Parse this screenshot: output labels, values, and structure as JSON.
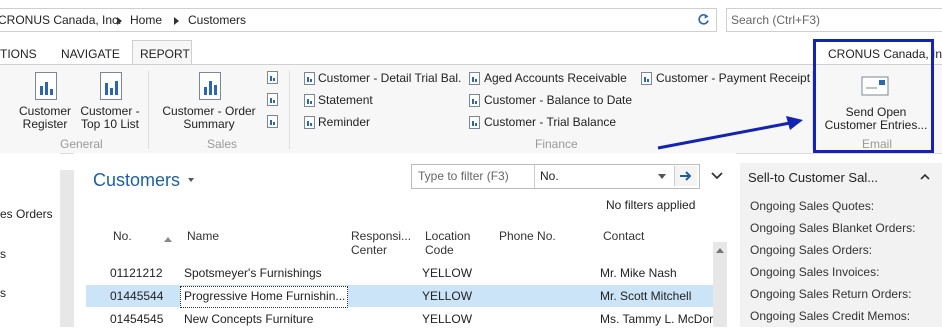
{
  "address": {
    "crumbs": [
      "CRONUS Canada, Inc.",
      "Home",
      "Customers"
    ],
    "search_placeholder": "Search (Ctrl+F3)"
  },
  "tabs": [
    "TIONS",
    "NAVIGATE",
    "REPORT"
  ],
  "company_label": "CRONUS Canada, Inc.",
  "ribbon": {
    "general": {
      "label": "General",
      "buttons": [
        "Customer Register",
        "Customer - Top 10 List"
      ]
    },
    "sales": {
      "label": "Sales",
      "buttons": [
        "Customer - Order Summary"
      ]
    },
    "finance": {
      "label": "Finance",
      "items": [
        "Customer - Detail Trial Bal.",
        "Statement",
        "Reminder",
        "Aged Accounts Receivable",
        "Customer - Balance to Date",
        "Customer - Trial Balance",
        "Customer - Payment Receipt"
      ]
    },
    "email": {
      "label": "Email",
      "button": "Send Open Customer Entries..."
    }
  },
  "leftnav": [
    "es Orders",
    "s",
    "s"
  ],
  "list": {
    "title": "Customers",
    "filter_placeholder": "Type to filter (F3)",
    "filter_field": "No.",
    "no_filters": "No filters applied",
    "columns": [
      "No.",
      "Name",
      "Responsi... Center",
      "Location Code",
      "Phone No.",
      "Contact"
    ],
    "rows": [
      {
        "no": "01121212",
        "name": "Spotsmeyer's Furnishings",
        "location": "YELLOW",
        "phone": "",
        "contact": "Mr. Mike Nash"
      },
      {
        "no": "01445544",
        "name": "Progressive Home Furnishin...",
        "location": "YELLOW",
        "phone": "",
        "contact": "Mr. Scott Mitchell"
      },
      {
        "no": "01454545",
        "name": "New Concepts Furniture",
        "location": "YELLOW",
        "phone": "",
        "contact": "Ms. Tammy L. McDor"
      }
    ]
  },
  "factbox": {
    "title": "Sell-to Customer Sal...",
    "items": [
      "Ongoing Sales Quotes:",
      "Ongoing Sales Blanket Orders:",
      "Ongoing Sales Orders:",
      "Ongoing Sales Invoices:",
      "Ongoing Sales Return Orders:",
      "Ongoing Sales Credit Memos:"
    ]
  },
  "colors": {
    "accent": "#1f5f9e",
    "highlight_box": "#1423b4",
    "selected_row": "#cce4f7"
  }
}
